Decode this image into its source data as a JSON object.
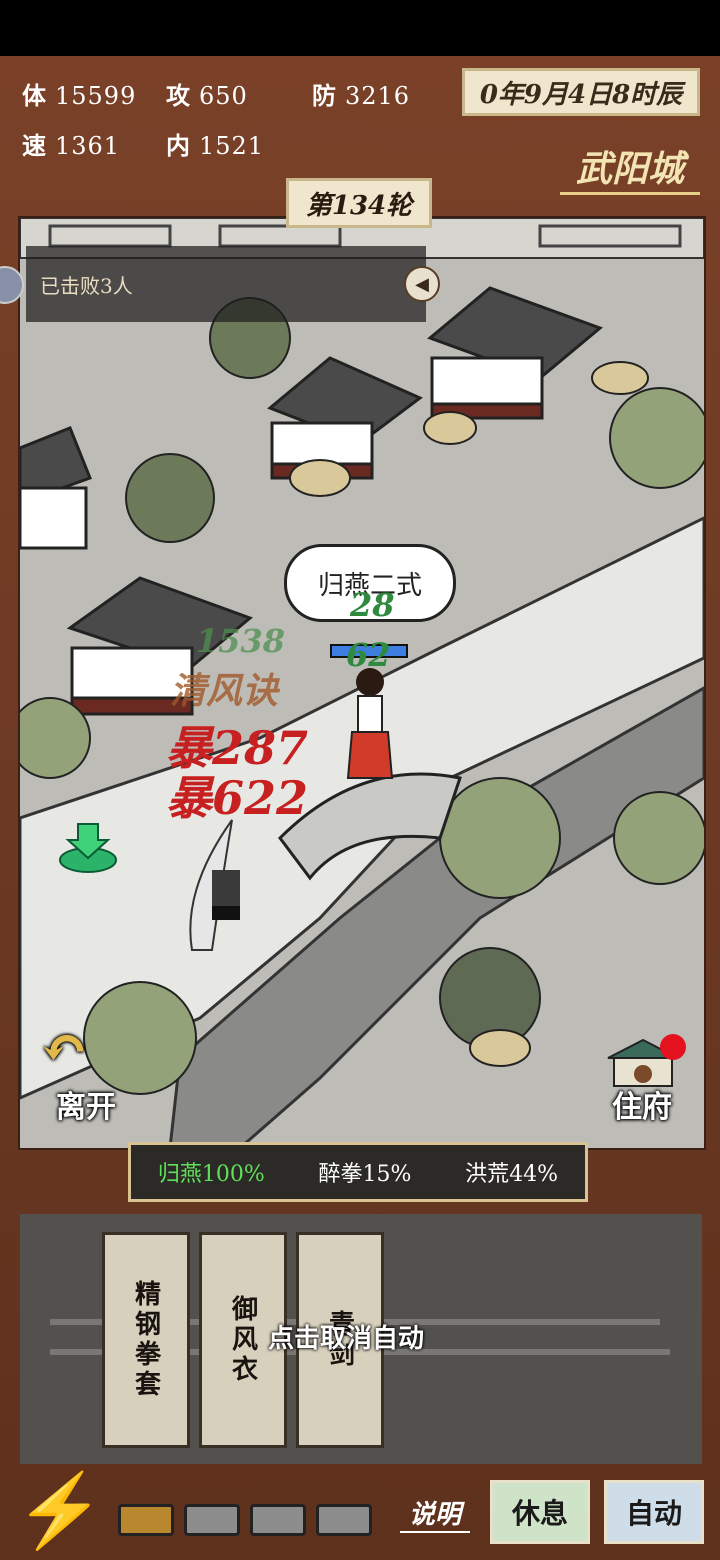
{
  "stats": {
    "hp": {
      "label": "体",
      "value": "15599"
    },
    "atk": {
      "label": "攻",
      "value": "650"
    },
    "def": {
      "label": "防",
      "value": "3216"
    },
    "spd": {
      "label": "速",
      "value": "1361"
    },
    "inner": {
      "label": "内",
      "value": "1521"
    }
  },
  "date": "0年9月4日8时辰",
  "city": "武阳城",
  "round": "第134轮",
  "defeat_text": "已击败3人",
  "battle": {
    "speech": "归燕二式",
    "dmg_green_1": "28",
    "dmg_green_2": "62",
    "dmg_faded": "1538",
    "skill_name": "清风诀",
    "crit_1": "暴287",
    "crit_2": "暴622",
    "enemy_hp_fraction": 1.0
  },
  "nav": {
    "leave": "离开",
    "home": "住府"
  },
  "skills": [
    {
      "name": "归燕",
      "pct": "100%",
      "color": "#5fe05a"
    },
    {
      "name": "醉拳",
      "pct": "15%",
      "color": "#ffffff"
    },
    {
      "name": "洪荒",
      "pct": "44%",
      "color": "#ffffff"
    }
  ],
  "items": [
    "精钢拳套",
    "御风衣",
    "青剑"
  ],
  "cancel_tip": "点击取消自动",
  "bottom": {
    "explain": "说明",
    "rest": "休息",
    "auto": "自动"
  },
  "energy_slots": [
    true,
    false,
    false,
    false
  ]
}
